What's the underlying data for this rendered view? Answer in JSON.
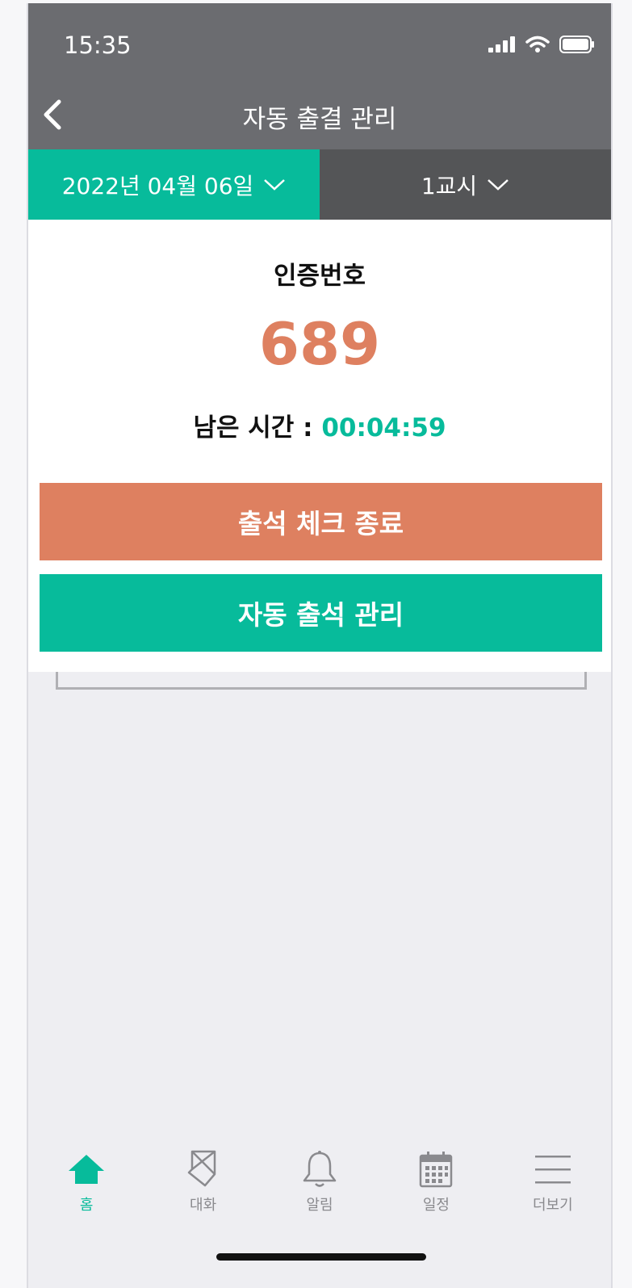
{
  "status_bar": {
    "time": "15:35"
  },
  "header": {
    "title": "자동 출결 관리"
  },
  "tabs": {
    "date": "2022년 04월 06일",
    "period": "1교시"
  },
  "card": {
    "label": "인증번호",
    "code": "689",
    "remaining_label": "남은 시간 : ",
    "remaining_time": "00:04:59"
  },
  "buttons": {
    "end_check": "출석 체크 종료",
    "auto_manage": "자동 출석 관리"
  },
  "bottom_nav": [
    {
      "label": "홈",
      "icon": "home-icon",
      "active": true
    },
    {
      "label": "대화",
      "icon": "chat-icon",
      "active": false
    },
    {
      "label": "알림",
      "icon": "bell-icon",
      "active": false
    },
    {
      "label": "일정",
      "icon": "calendar-icon",
      "active": false
    },
    {
      "label": "더보기",
      "icon": "menu-icon",
      "active": false
    }
  ],
  "colors": {
    "accent": "#07bb9b",
    "orange": "#de8060",
    "header": "#6b6c70",
    "tab_dark": "#545557"
  }
}
